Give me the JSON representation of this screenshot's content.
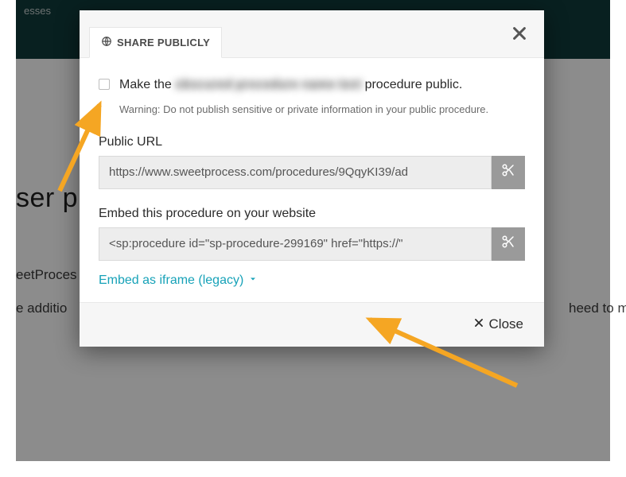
{
  "background": {
    "nav_item": "esses",
    "page_title_fragment": "ser pl",
    "line1_fragment": "eetProces",
    "line2_left_fragment": "e additio",
    "line2_right_fragment": "heed to man"
  },
  "modal": {
    "tab_label": "SHARE PUBLICLY",
    "checkbox_text_prefix": "Make the ",
    "checkbox_text_blurred": "obscured procedure name text",
    "checkbox_text_suffix": " procedure public.",
    "warning": "Warning: Do not publish sensitive or private information in your public procedure.",
    "public_url_label": "Public URL",
    "public_url_value": "https://www.sweetprocess.com/procedures/9QqyKI39/ad",
    "embed_label": "Embed this procedure on your website",
    "embed_value": "<sp:procedure id=\"sp-procedure-299169\" href=\"https://\"",
    "legacy_link": "Embed as iframe (legacy)",
    "footer_close": "Close"
  },
  "colors": {
    "teal_header": "#0f3b3b",
    "link": "#17a2b8",
    "arrow": "#f5a623"
  }
}
